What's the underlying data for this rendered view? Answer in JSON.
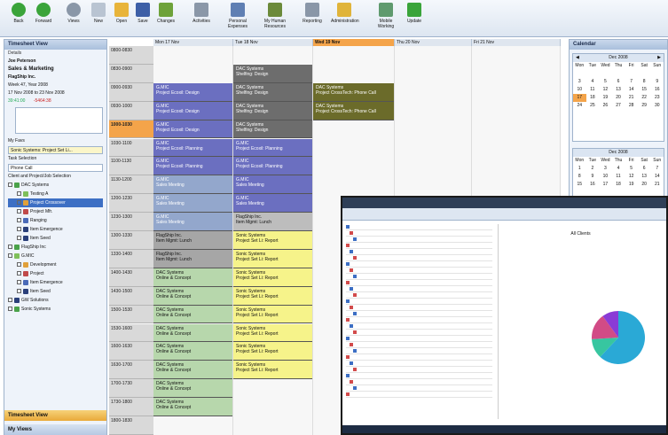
{
  "toolbar": {
    "buttons": [
      {
        "label": "Back",
        "icon": "back-arrow-icon",
        "color": "#3aa43a"
      },
      {
        "label": "Forward",
        "icon": "forward-arrow-icon",
        "color": "#3aa43a"
      },
      {
        "label": "Views",
        "icon": "views-icon",
        "color": "#8a97a8"
      },
      {
        "label": "New",
        "icon": "new-doc-icon",
        "color": "#b9c4d2"
      },
      {
        "label": "Open",
        "icon": "open-folder-icon",
        "color": "#e8b43a"
      },
      {
        "label": "Save",
        "icon": "save-disk-icon",
        "color": "#3d5fa7"
      },
      {
        "label": "Changes",
        "icon": "changes-icon",
        "color": "#6ea23a"
      },
      {
        "label": "Activities",
        "icon": "activities-icon",
        "color": "#8a97a8"
      },
      {
        "label": "Personal Expenses",
        "icon": "expenses-icon",
        "color": "#5f7fb3"
      },
      {
        "label": "My Human Resources",
        "icon": "human-resources-icon",
        "color": "#6b8a3a"
      },
      {
        "label": "Reporting",
        "icon": "reporting-icon",
        "color": "#8a97a8"
      },
      {
        "label": "Administration",
        "icon": "administration-icon",
        "color": "#e0b43a"
      },
      {
        "label": "Mobile Working",
        "icon": "mobile-working-icon",
        "color": "#5f9a6e"
      },
      {
        "label": "Update",
        "icon": "update-icon",
        "color": "#3aa43a"
      }
    ]
  },
  "left_panel": {
    "title": "Timesheet View",
    "details_label": "Details",
    "user": "Joe Peterson",
    "department": "Sales & Marketing",
    "company": "FlagShip Inc.",
    "week": "Week 47, Year 2008",
    "date_range": "17 Nov 2008 to 23 Nov 2008",
    "hours_a": "39:41:00",
    "hours_b": "-5464:38",
    "my_favs_label": "My Favs",
    "my_favs_value": "Sonic Systems: Project Set Li...",
    "task_selection_label": "Task Selection",
    "task_selection_value": "Phone Call",
    "client_label": "Client and Project/Job Selection",
    "tree": [
      {
        "label": "DAC Systems",
        "level": 0
      },
      {
        "label": "Testing A",
        "level": 1
      },
      {
        "label": "Project Crossover",
        "level": 1
      },
      {
        "label": "Project Mfr.",
        "level": 1
      },
      {
        "label": "Ranging",
        "level": 1
      },
      {
        "label": "Item Emergence",
        "level": 1
      },
      {
        "label": "Item Seed",
        "level": 1
      },
      {
        "label": "FlagShip Inc",
        "level": 0
      },
      {
        "label": "G.MIC",
        "level": 0
      },
      {
        "label": "Development",
        "level": 1
      },
      {
        "label": "Project",
        "level": 1
      },
      {
        "label": "Item Emergence",
        "level": 1
      },
      {
        "label": "Item Seed",
        "level": 1
      },
      {
        "label": "GW Solutions",
        "level": 0
      },
      {
        "label": "Sonic Systems",
        "level": 0
      }
    ],
    "bottom_a": "Timesheet View",
    "bottom_b": "My Views"
  },
  "schedule": {
    "headers": [
      "Mon 17 Nov",
      "Tue 18 Nov",
      "Wed 19 Nov",
      "Thu 20 Nov",
      "Fri 21 Nov"
    ],
    "times": [
      "0800-0830",
      "0830-0900",
      "0900-0930",
      "0930-1000",
      "1000-1030",
      "1030-1100",
      "1100-1130",
      "1130-1200",
      "1200-1230",
      "1230-1300",
      "1300-1330",
      "1330-1400",
      "1400-1430",
      "1430-1500",
      "1500-1530",
      "1530-1600",
      "1600-1630",
      "1630-1700",
      "1700-1730",
      "1730-1800",
      "1800-1830"
    ],
    "events": [
      {
        "col": 1,
        "row": 1,
        "rows": 1,
        "line1": "DAC Systems",
        "line2": "Shelfing: Design",
        "color": "#6d6d6d"
      },
      {
        "col": 1,
        "row": 2,
        "rows": 1,
        "line1": "DAC Systems",
        "line2": "Shelfing: Design",
        "color": "#6d6d6d"
      },
      {
        "col": 1,
        "row": 3,
        "rows": 1,
        "line1": "DAC Systems",
        "line2": "Shelfing: Design",
        "color": "#6d6d6d"
      },
      {
        "col": 1,
        "row": 4,
        "rows": 1,
        "line1": "DAC Systems",
        "line2": "Shelfing: Design",
        "color": "#6d6d6d"
      },
      {
        "col": 0,
        "row": 2,
        "rows": 1,
        "line1": "G.MIC",
        "line2": "Project Ecoxil: Design",
        "color": "#6b6fc0"
      },
      {
        "col": 0,
        "row": 3,
        "rows": 1,
        "line1": "G.MIC",
        "line2": "Project Ecoxil: Design",
        "color": "#6b6fc0"
      },
      {
        "col": 0,
        "row": 4,
        "rows": 1,
        "line1": "G.MIC",
        "line2": "Project Ecoxil: Design",
        "color": "#6b6fc0"
      },
      {
        "col": 0,
        "row": 5,
        "rows": 1,
        "line1": "G.MIC",
        "line2": "Project Ecoxil: Planning",
        "color": "#6b6fc0"
      },
      {
        "col": 0,
        "row": 6,
        "rows": 1,
        "line1": "G.MIC",
        "line2": "Project Ecoxil: Planning",
        "color": "#6b6fc0"
      },
      {
        "col": 0,
        "row": 7,
        "rows": 1,
        "line1": "G.MIC",
        "line2": "Sales Meeting",
        "color": "#93a7cc"
      },
      {
        "col": 0,
        "row": 8,
        "rows": 1,
        "line1": "G.MIC",
        "line2": "Sales Meeting",
        "color": "#93a7cc"
      },
      {
        "col": 0,
        "row": 9,
        "rows": 1,
        "line1": "G.MIC",
        "line2": "Sales Meeting",
        "color": "#93a7cc"
      },
      {
        "col": 0,
        "row": 10,
        "rows": 1,
        "line1": "FlagShip Inc.",
        "line2": "Item Mgmt: Lunch",
        "color": "#a6a6a6"
      },
      {
        "col": 0,
        "row": 11,
        "rows": 1,
        "line1": "FlagShip Inc.",
        "line2": "Item Mgmt: Lunch",
        "color": "#a6a6a6"
      },
      {
        "col": 0,
        "row": 12,
        "rows": 1,
        "line1": "DAC Systems",
        "line2": "Online & Concept",
        "color": "#b7d7ac"
      },
      {
        "col": 0,
        "row": 13,
        "rows": 1,
        "line1": "DAC Systems",
        "line2": "Online & Concept",
        "color": "#b7d7ac"
      },
      {
        "col": 0,
        "row": 14,
        "rows": 1,
        "line1": "DAC Systems",
        "line2": "Online & Concept",
        "color": "#b7d7ac"
      },
      {
        "col": 0,
        "row": 15,
        "rows": 1,
        "line1": "DAC Systems",
        "line2": "Online & Concept",
        "color": "#b7d7ac"
      },
      {
        "col": 0,
        "row": 16,
        "rows": 1,
        "line1": "DAC Systems",
        "line2": "Online & Concept",
        "color": "#b7d7ac"
      },
      {
        "col": 0,
        "row": 17,
        "rows": 1,
        "line1": "DAC Systems",
        "line2": "Online & Concept",
        "color": "#b7d7ac"
      },
      {
        "col": 0,
        "row": 18,
        "rows": 1,
        "line1": "DAC Systems",
        "line2": "Online & Concept",
        "color": "#b7d7ac"
      },
      {
        "col": 0,
        "row": 19,
        "rows": 1,
        "line1": "DAC Systems",
        "line2": "Online & Concept",
        "color": "#b7d7ac"
      },
      {
        "col": 1,
        "row": 5,
        "rows": 1,
        "line1": "G.MIC",
        "line2": "Project Ecoxil: Planning",
        "color": "#6b6fc0"
      },
      {
        "col": 1,
        "row": 6,
        "rows": 1,
        "line1": "G.MIC",
        "line2": "Project Ecoxil: Planning",
        "color": "#6b6fc0"
      },
      {
        "col": 1,
        "row": 7,
        "rows": 1,
        "line1": "G.MIC",
        "line2": "Sales Meeting",
        "color": "#6b6fc0"
      },
      {
        "col": 1,
        "row": 8,
        "rows": 1,
        "line1": "G.MIC",
        "line2": "Sales Meeting",
        "color": "#6b6fc0"
      },
      {
        "col": 1,
        "row": 9,
        "rows": 1,
        "line1": "FlagShip Inc.",
        "line2": "Item Mgmt: Lunch",
        "color": "#bdbdbd"
      },
      {
        "col": 1,
        "row": 10,
        "rows": 1,
        "line1": "Sonic Systems",
        "line2": "Project Set Li: Report",
        "color": "#f6f38a"
      },
      {
        "col": 1,
        "row": 11,
        "rows": 1,
        "line1": "Sonic Systems",
        "line2": "Project Set Li: Report",
        "color": "#f6f38a"
      },
      {
        "col": 1,
        "row": 12,
        "rows": 1,
        "line1": "Sonic Systems",
        "line2": "Project Set Li: Report",
        "color": "#f6f38a"
      },
      {
        "col": 1,
        "row": 13,
        "rows": 1,
        "line1": "Sonic Systems",
        "line2": "Project Set Li: Report",
        "color": "#f6f38a"
      },
      {
        "col": 1,
        "row": 14,
        "rows": 1,
        "line1": "Sonic Systems",
        "line2": "Project Set Li: Report",
        "color": "#f6f38a"
      },
      {
        "col": 1,
        "row": 15,
        "rows": 1,
        "line1": "Sonic Systems",
        "line2": "Project Set Li: Report",
        "color": "#f6f38a"
      },
      {
        "col": 1,
        "row": 16,
        "rows": 1,
        "line1": "Sonic Systems",
        "line2": "Project Set Li: Report",
        "color": "#f6f38a"
      },
      {
        "col": 1,
        "row": 17,
        "rows": 1,
        "line1": "Sonic Systems",
        "line2": "Project Set Li: Report",
        "color": "#f6f38a"
      },
      {
        "col": 2,
        "row": 2,
        "rows": 1,
        "line1": "DAC Systems",
        "line2": "Project CrossTech: Phone Call",
        "color": "#6b6b2a"
      },
      {
        "col": 2,
        "row": 3,
        "rows": 1,
        "line1": "DAC Systems",
        "line2": "Project CrossTech: Phone Call",
        "color": "#6b6b2a"
      }
    ]
  },
  "calendar": {
    "title": "Calendar",
    "month1": "Dec 2008",
    "month2": "Dec 2008",
    "dow": [
      "Mon",
      "Tue",
      "Wed",
      "Thu",
      "Fri",
      "Sat",
      "Sun"
    ],
    "weeks1": [
      [
        "",
        "",
        "",
        "",
        "",
        "",
        ""
      ],
      [
        "3",
        "4",
        "5",
        "6",
        "7",
        "8",
        "9"
      ],
      [
        "10",
        "11",
        "12",
        "13",
        "14",
        "15",
        "16"
      ],
      [
        "17",
        "18",
        "19",
        "20",
        "21",
        "22",
        "23"
      ],
      [
        "24",
        "25",
        "26",
        "27",
        "28",
        "29",
        "30"
      ]
    ],
    "weeks2": [
      [
        "1",
        "2",
        "3",
        "4",
        "5",
        "6",
        "7"
      ],
      [
        "8",
        "9",
        "10",
        "11",
        "12",
        "13",
        "14"
      ],
      [
        "15",
        "16",
        "17",
        "18",
        "19",
        "20",
        "21"
      ]
    ],
    "today": "17"
  },
  "overlay": {
    "chart_title": "All Clients",
    "pie_colors": [
      "#2aa9d6",
      "#37c6a0",
      "#d24b86",
      "#8a3bd6"
    ]
  }
}
